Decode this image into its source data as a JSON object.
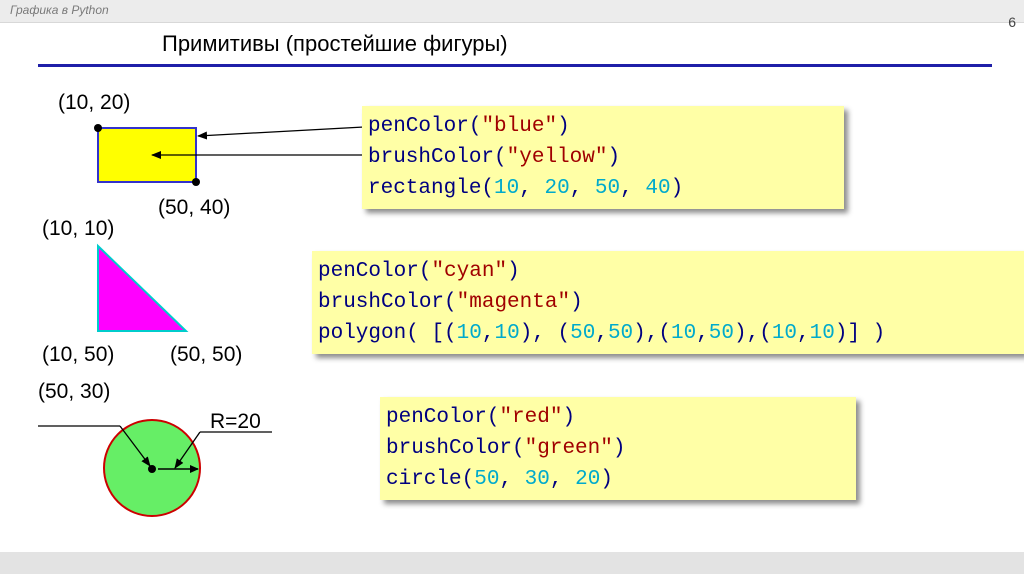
{
  "header": {
    "subtitle": "Графика в Python",
    "page_number": "6",
    "title": "Примитивы (простейшие фигуры)"
  },
  "colors": {
    "accent_rule": "#1f1fa8",
    "code_bg": "#ffffa6",
    "code_func": "#000080",
    "code_string": "#a00000",
    "code_number": "#00aacc"
  },
  "rectangle_example": {
    "label_top_left": "(10, 20)",
    "label_bottom_right": "(50, 40)",
    "fill": "#ffff00",
    "stroke": "#3333cc",
    "code": {
      "l1_fn": "penColor",
      "l1_open": "(",
      "l1_str": "\"blue\"",
      "l1_close": ")",
      "l2_fn": "brushColor",
      "l2_open": "(",
      "l2_str": "\"yellow\"",
      "l2_close": ")",
      "l3_fn": "rectangle",
      "l3_open": "(",
      "l3_n1": "10",
      "l3_s1": ", ",
      "l3_n2": "20",
      "l3_s2": ", ",
      "l3_n3": "50",
      "l3_s3": ", ",
      "l3_n4": "40",
      "l3_close": ")"
    }
  },
  "polygon_example": {
    "label_top": "(10, 10)",
    "label_bottom_left": "(10, 50)",
    "label_bottom_right": "(50, 50)",
    "fill": "#ff00ff",
    "stroke": "#00cccc",
    "code": {
      "l1_fn": "penColor",
      "l1_open": "(",
      "l1_str": "\"cyan\"",
      "l1_close": ")",
      "l2_fn": "brushColor",
      "l2_open": "(",
      "l2_str": "\"magenta\"",
      "l2_close": ")",
      "l3_fn": "polygon",
      "l3_open": "( [(",
      "l3_n1": "10",
      "l3_c1": ",",
      "l3_n2": "10",
      "l3_p1": "), (",
      "l3_n3": "50",
      "l3_c2": ",",
      "l3_n4": "50",
      "l3_p2": "),(",
      "l3_n5": "10",
      "l3_c3": ",",
      "l3_n6": "50",
      "l3_p3": "),(",
      "l3_n7": "10",
      "l3_c4": ",",
      "l3_n8": "10",
      "l3_close": ")] )"
    }
  },
  "circle_example": {
    "label_center": "(50, 30)",
    "label_radius": "R=20",
    "fill": "#66ee66",
    "stroke": "#cc0000",
    "code": {
      "l1_fn": "penColor",
      "l1_open": "(",
      "l1_str": "\"red\"",
      "l1_close": ")",
      "l2_fn": "brushColor",
      "l2_open": "(",
      "l2_str": "\"green\"",
      "l2_close": ")",
      "l3_fn": "circle",
      "l3_open": "(",
      "l3_n1": "50",
      "l3_s1": ", ",
      "l3_n2": "30",
      "l3_s2": ", ",
      "l3_n3": "20",
      "l3_close": ")"
    }
  }
}
